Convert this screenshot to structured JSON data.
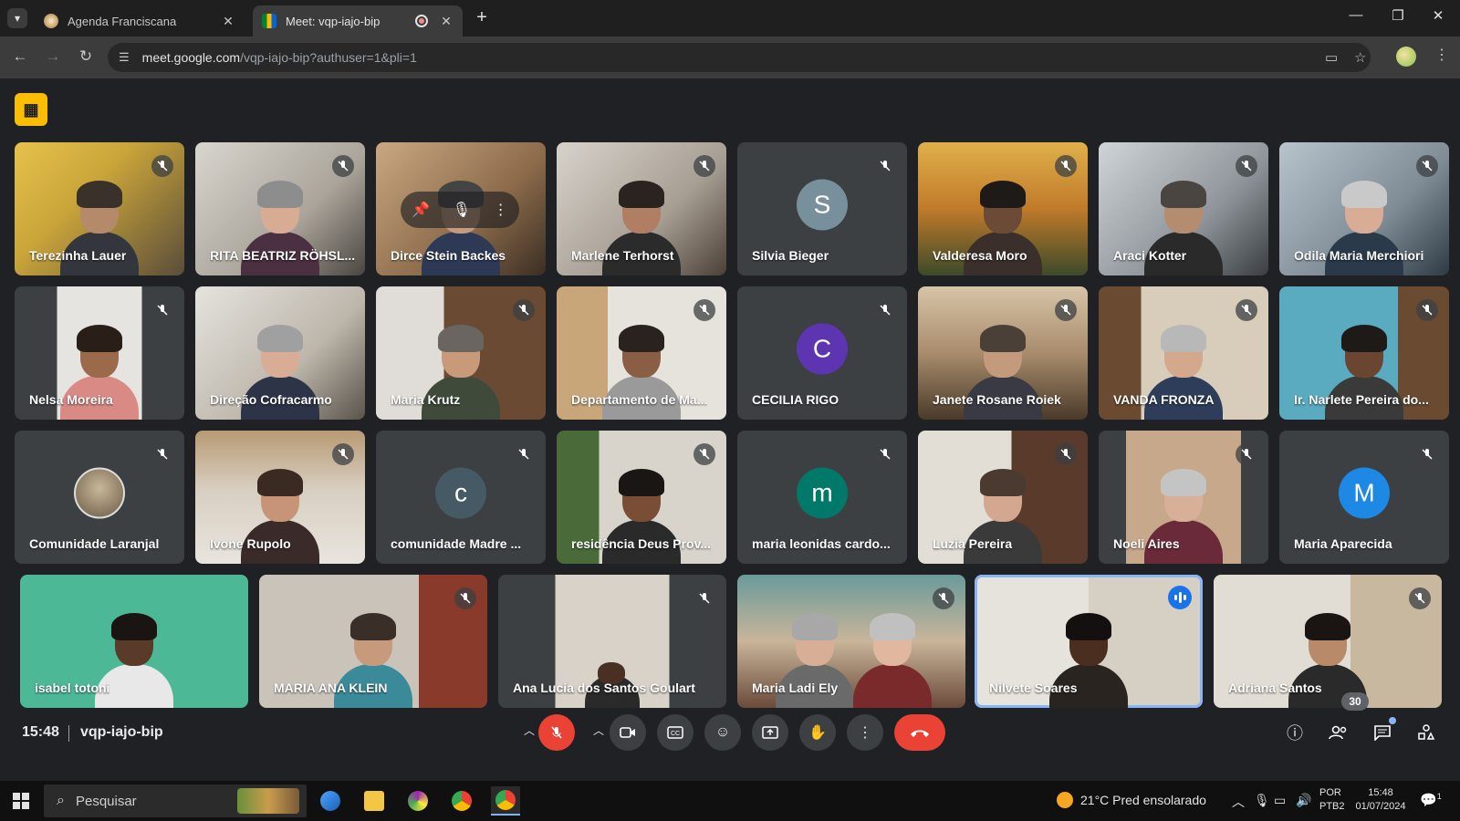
{
  "browser": {
    "tabs": [
      {
        "title": "Agenda Franciscana",
        "active": false
      },
      {
        "title": "Meet: vqp-iajo-bip",
        "active": true
      }
    ],
    "url_host": "meet.google.com",
    "url_path": "/vqp-iajo-bip?authuser=1&pli=1"
  },
  "meet": {
    "participants": [
      {
        "name": "Terezinha Lauer",
        "muted": true,
        "camera": true
      },
      {
        "name": "RITA BEATRIZ RÖHSL...",
        "muted": true,
        "camera": true
      },
      {
        "name": "Dirce Stein Backes",
        "muted": false,
        "camera": true
      },
      {
        "name": "Marlene Terhorst",
        "muted": true,
        "camera": true
      },
      {
        "name": "Silvia Bieger",
        "muted": true,
        "camera": false,
        "initial": "S",
        "avatar_color": "#78909c"
      },
      {
        "name": "Valderesa Moro",
        "muted": true,
        "camera": true
      },
      {
        "name": "Araci Kotter",
        "muted": true,
        "camera": true
      },
      {
        "name": "Odila Maria Merchiori",
        "muted": true,
        "camera": true
      },
      {
        "name": "Nelsa Moreira",
        "muted": true,
        "camera": true
      },
      {
        "name": "Direção Cofracarmo",
        "muted": false,
        "camera": true
      },
      {
        "name": "Maria Krutz",
        "muted": true,
        "camera": true
      },
      {
        "name": "Departamento de Ma...",
        "muted": true,
        "camera": true
      },
      {
        "name": "CECILIA RIGO",
        "muted": true,
        "camera": false,
        "initial": "C",
        "avatar_color": "#5e35b1"
      },
      {
        "name": "Janete Rosane Roiek",
        "muted": true,
        "camera": true
      },
      {
        "name": "VANDA FRONZA",
        "muted": true,
        "camera": true
      },
      {
        "name": "Ir. Narlete Pereira do...",
        "muted": true,
        "camera": true
      },
      {
        "name": "Comunidade Laranjal",
        "muted": true,
        "camera": false,
        "initial": "",
        "avatar_color": "photo"
      },
      {
        "name": "Ivone Rupolo",
        "muted": true,
        "camera": true
      },
      {
        "name": "comunidade Madre ...",
        "muted": true,
        "camera": false,
        "initial": "c",
        "avatar_color": "#455a64"
      },
      {
        "name": "residência Deus Prov...",
        "muted": true,
        "camera": true
      },
      {
        "name": "maria leonidas cardo...",
        "muted": true,
        "camera": false,
        "initial": "m",
        "avatar_color": "#00796b"
      },
      {
        "name": "Luzia Pereira",
        "muted": true,
        "camera": true
      },
      {
        "name": "Noeli Aires",
        "muted": true,
        "camera": true
      },
      {
        "name": "Maria Aparecida",
        "muted": true,
        "camera": false,
        "initial": "M",
        "avatar_color": "#1e88e5"
      },
      {
        "name": "isabel totoni",
        "muted": false,
        "camera": true
      },
      {
        "name": "MARIA ANA KLEIN",
        "muted": true,
        "camera": true
      },
      {
        "name": "Ana Lucia dos Santos Goulart",
        "muted": true,
        "camera": true
      },
      {
        "name": "Maria Ladi Ely",
        "muted": true,
        "camera": true
      },
      {
        "name": "Nilvete Soares",
        "muted": false,
        "camera": true,
        "speaking": true
      },
      {
        "name": "Adriana Santos",
        "muted": true,
        "camera": true
      }
    ],
    "time": "15:48",
    "meeting_code": "vqp-iajo-bip",
    "participant_count": "30"
  },
  "taskbar": {
    "search_placeholder": "Pesquisar",
    "weather": "21°C  Pred ensolarado",
    "lang_line1": "POR",
    "lang_line2": "PTB2",
    "clock_time": "15:48",
    "clock_date": "01/07/2024",
    "notif_count": "1"
  }
}
